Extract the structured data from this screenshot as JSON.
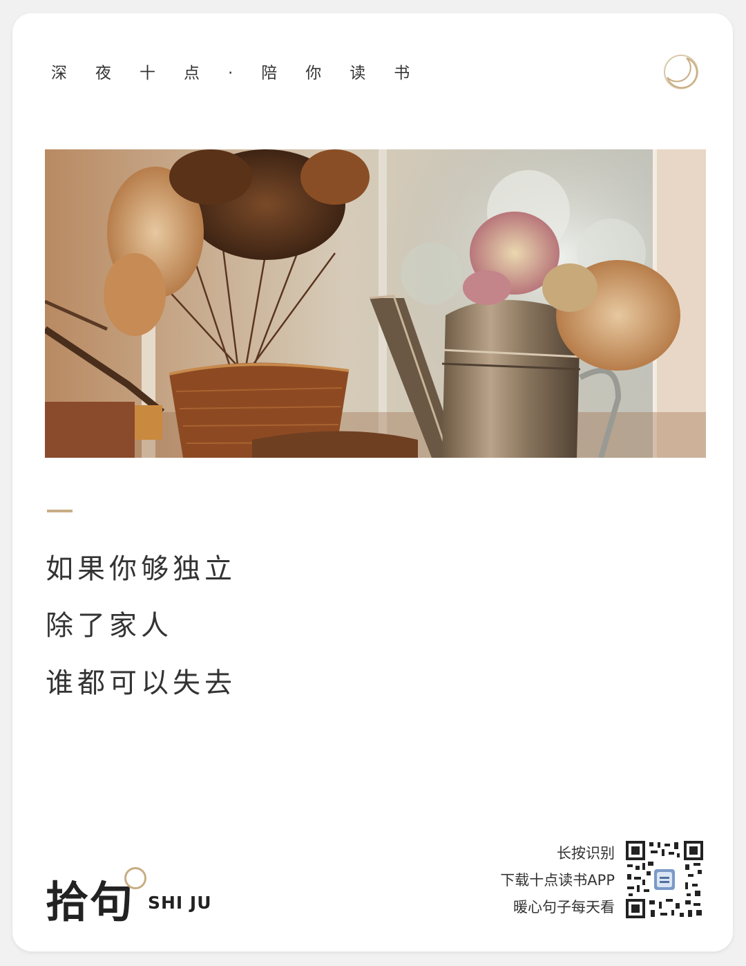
{
  "header": {
    "title": "深夜十点·陪你读书"
  },
  "quote": {
    "lines": [
      "如果你够独立",
      "除了家人",
      "谁都可以失去"
    ]
  },
  "brand": {
    "name": "拾句",
    "sub": "SHI JU"
  },
  "promo": {
    "lines": [
      "长按识别",
      "下载十点读书APP",
      "暖心句子每天看"
    ]
  },
  "colors": {
    "accent": "#c8ad84",
    "text": "#333333",
    "card": "#ffffff"
  },
  "icons": {
    "moon": "moon-icon",
    "qr": "qr-code"
  }
}
